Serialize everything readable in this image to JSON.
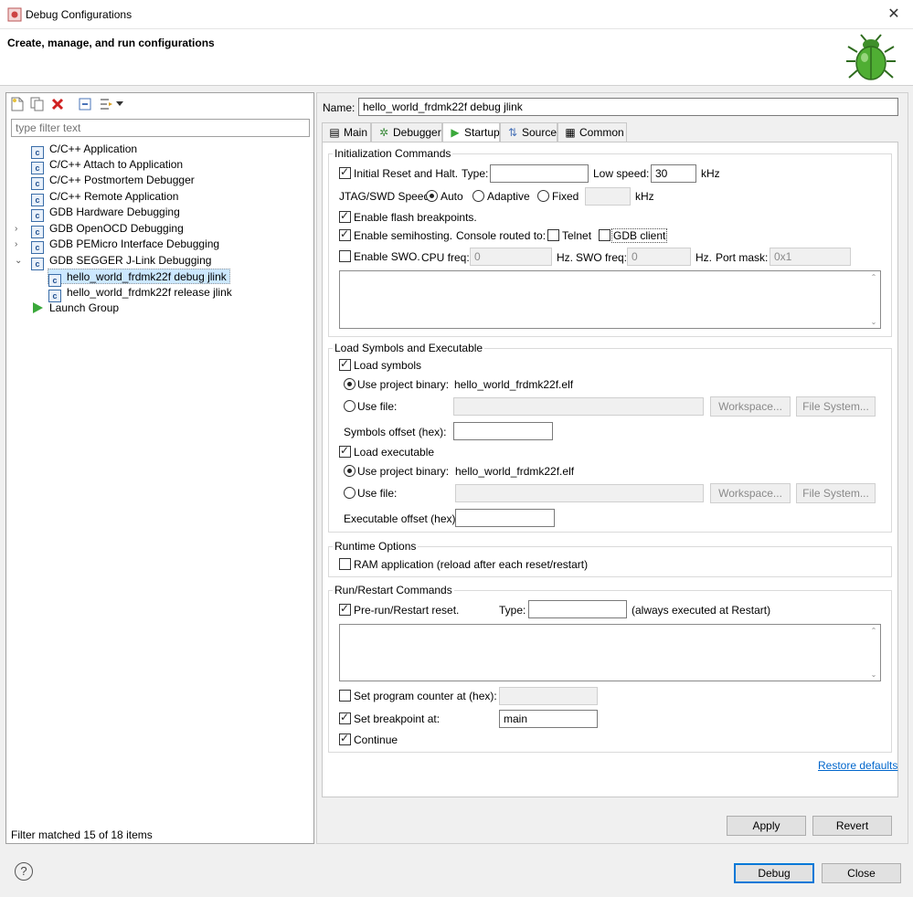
{
  "window": {
    "title": "Debug Configurations",
    "close_glyph": "✕"
  },
  "banner": {
    "title": "Create, manage, and run configurations",
    "icon": "bug-icon"
  },
  "left": {
    "filter_placeholder": "type filter text",
    "tree": [
      {
        "label": "C/C++ Application",
        "icon": "c-config-icon",
        "expand": ""
      },
      {
        "label": "C/C++ Attach to Application",
        "icon": "c-config-icon",
        "expand": ""
      },
      {
        "label": "C/C++ Postmortem Debugger",
        "icon": "c-config-icon",
        "expand": ""
      },
      {
        "label": "C/C++ Remote Application",
        "icon": "c-config-icon",
        "expand": ""
      },
      {
        "label": "GDB Hardware Debugging",
        "icon": "c-config-icon",
        "expand": ""
      },
      {
        "label": "GDB OpenOCD Debugging",
        "icon": "c-config-icon",
        "expand": "›"
      },
      {
        "label": "GDB PEMicro Interface Debugging",
        "icon": "c-config-icon",
        "expand": "›"
      },
      {
        "label": "GDB SEGGER J-Link Debugging",
        "icon": "c-config-icon",
        "expand": "⌄"
      },
      {
        "label": "hello_world_frdmk22f debug jlink",
        "icon": "c-config-icon",
        "expand": ""
      },
      {
        "label": "hello_world_frdmk22f release jlink",
        "icon": "c-config-icon",
        "expand": ""
      },
      {
        "label": "Launch Group",
        "icon": "launch-group-icon",
        "expand": ""
      }
    ],
    "status": "Filter matched 15 of 18 items"
  },
  "right": {
    "name_label": "Name:",
    "name_value": "hello_world_frdmk22f debug jlink",
    "tabs": [
      {
        "label": "Main",
        "icon": "▤"
      },
      {
        "label": "Debugger",
        "icon": "✲"
      },
      {
        "label": "Startup",
        "icon": "▶"
      },
      {
        "label": "Source",
        "icon": "⇅"
      },
      {
        "label": "Common",
        "icon": "▦"
      }
    ],
    "init": {
      "title": "Initialization Commands",
      "initial_reset": "Initial Reset and Halt.",
      "type_label": "Type:",
      "type_value": "",
      "low_speed_label": "Low speed:",
      "low_speed_value": "30",
      "khz": "kHz",
      "jtag_label": "JTAG/SWD Speed:",
      "auto": "Auto",
      "adaptive": "Adaptive",
      "fixed": "Fixed",
      "fixed_value": "",
      "flash_bp": "Enable flash breakpoints.",
      "semihosting": "Enable semihosting.",
      "console_routed": "Console routed to:",
      "telnet": "Telnet",
      "gdb_client": "GDB client",
      "swo": "Enable SWO.",
      "cpu_freq_label": "CPU freq:",
      "cpu_freq_value": "0",
      "hz1": "Hz.",
      "swo_freq_label": "SWO freq:",
      "swo_freq_value": "0",
      "hz2": "Hz.",
      "port_mask_label": "Port mask:",
      "port_mask_value": "0x1"
    },
    "load": {
      "title": "Load Symbols and Executable",
      "load_symbols": "Load symbols",
      "use_project_binary": "Use project binary:",
      "symbols_binary": "hello_world_frdmk22f.elf",
      "use_file": "Use file:",
      "workspace": "Workspace...",
      "file_system": "File System...",
      "symbols_offset": "Symbols offset (hex):",
      "load_executable": "Load executable",
      "exec_binary": "hello_world_frdmk22f.elf",
      "exec_offset": "Executable offset (hex):"
    },
    "runtime": {
      "title": "Runtime Options",
      "ram_app": "RAM application (reload after each reset/restart)"
    },
    "run": {
      "title": "Run/Restart Commands",
      "pre_run": "Pre-run/Restart reset.",
      "type_label": "Type:",
      "type_value": "",
      "always": "(always executed at Restart)",
      "set_pc": "Set program counter at (hex):",
      "set_bp": "Set breakpoint at:",
      "bp_value": "main",
      "continue": "Continue"
    },
    "restore_defaults": "Restore defaults",
    "apply": "Apply",
    "revert": "Revert"
  },
  "footer": {
    "help": "?",
    "debug": "Debug",
    "close": "Close"
  }
}
